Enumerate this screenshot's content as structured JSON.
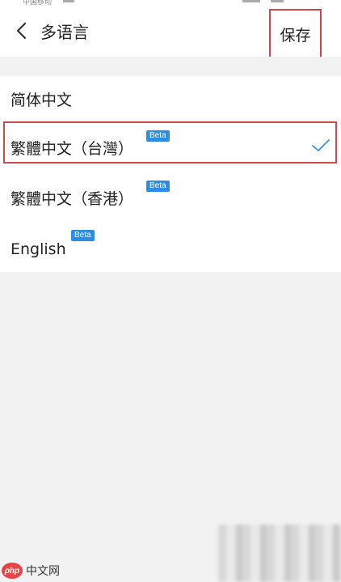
{
  "status_bar": {
    "carrier": "中国移动"
  },
  "nav": {
    "back_icon": "chevron-left-icon",
    "title": "多语言",
    "save_label": "保存"
  },
  "languages": [
    {
      "label": "简体中文",
      "beta": "",
      "selected": false
    },
    {
      "label": "繁體中文（台灣）",
      "beta": "Beta",
      "selected": true
    },
    {
      "label": "繁體中文（香港）",
      "beta": "Beta",
      "selected": false
    },
    {
      "label": "English",
      "beta": "Beta",
      "selected": false
    }
  ],
  "watermark": {
    "logo": "php",
    "text": "中文网"
  },
  "colors": {
    "highlight_border": "#c9494e",
    "beta_badge": "#2b8de6",
    "check": "#3a8fe0",
    "background": "#f2f2f2"
  }
}
